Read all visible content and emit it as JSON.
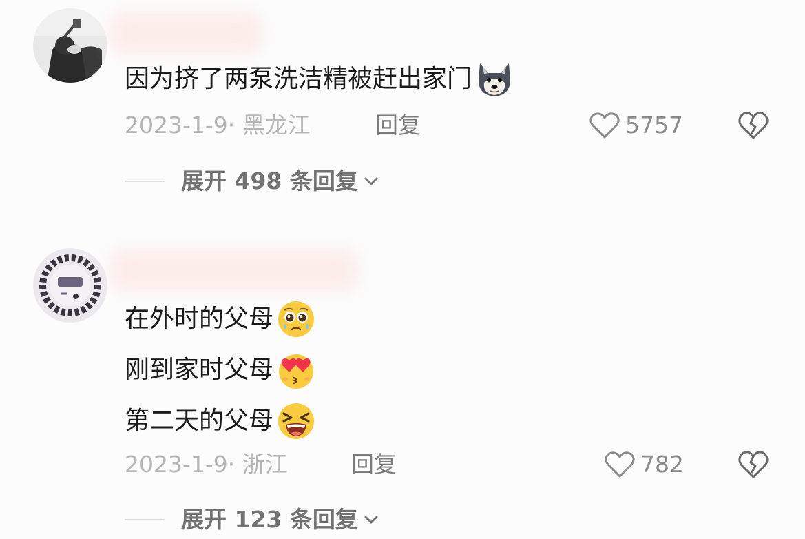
{
  "comments": [
    {
      "lines": [
        {
          "text": "因为挤了两泵洗洁精被赶出家门",
          "emoji": "dog-emoji"
        }
      ],
      "date": "2023-1-9",
      "separator": "·",
      "location": "黑龙江",
      "reply_label": "回复",
      "likes": "5757",
      "expand_label": "展开 498 条回复"
    },
    {
      "lines": [
        {
          "text": "在外时的父母",
          "emoji": "pleading-face-emoji"
        },
        {
          "text": "刚到家时父母",
          "emoji": "heart-eyes-kiss-emoji"
        },
        {
          "text": "第二天的父母",
          "emoji": "squinting-laugh-emoji"
        }
      ],
      "date": "2023-1-9",
      "separator": "·",
      "location": "浙江",
      "reply_label": "回复",
      "likes": "782",
      "expand_label": "展开 123 条回复"
    }
  ],
  "icons": {
    "like": "heart-outline-icon",
    "dislike": "broken-heart-icon",
    "expand": "chevron-down-icon"
  },
  "colors": {
    "text": "#1b1b1b",
    "meta": "#b5b5b5",
    "reply": "#7c7c7c",
    "background": "#fcfcfc"
  }
}
